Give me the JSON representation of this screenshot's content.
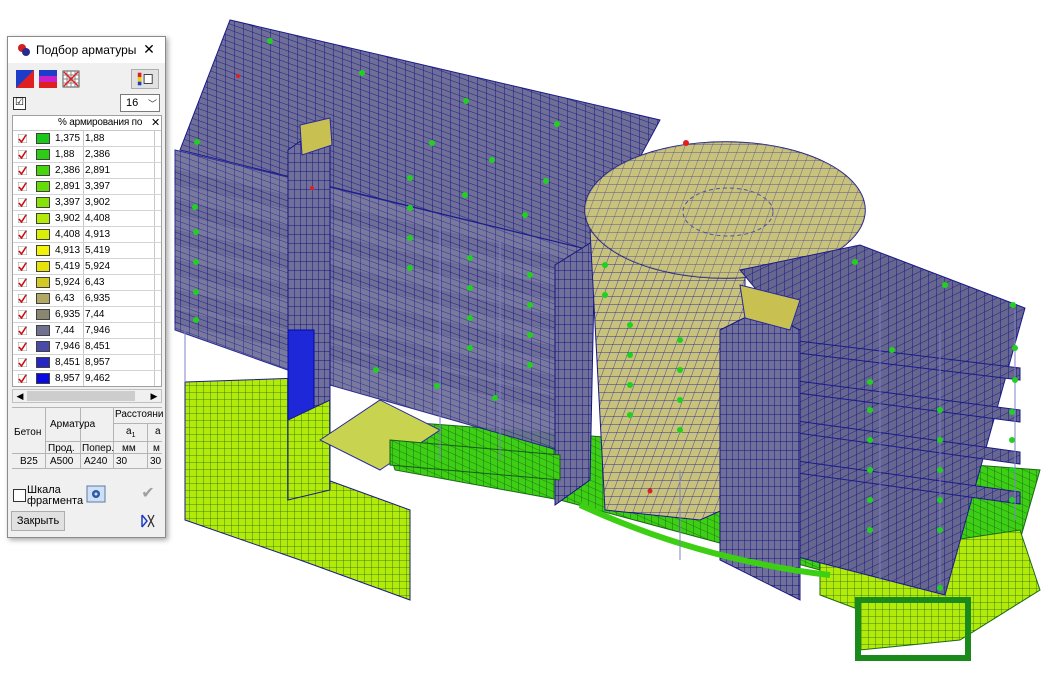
{
  "dialog": {
    "title": "Подбор арматуры",
    "close_glyph": "✕",
    "combo_value": "16",
    "checkbox_checked": "☑",
    "grid_header": "% армирования по",
    "grid_header_close": "✕",
    "rows": [
      {
        "from": "1,375",
        "to": "1,88",
        "color": "#19c819"
      },
      {
        "from": "1,88",
        "to": "2,386",
        "color": "#2ccd14"
      },
      {
        "from": "2,386",
        "to": "2,891",
        "color": "#46d40d"
      },
      {
        "from": "2,891",
        "to": "3,397",
        "color": "#64dc0a"
      },
      {
        "from": "3,397",
        "to": "3,902",
        "color": "#86e20a"
      },
      {
        "from": "3,902",
        "to": "4,408",
        "color": "#b4ea0a"
      },
      {
        "from": "4,408",
        "to": "4,913",
        "color": "#d9ef0a"
      },
      {
        "from": "4,913",
        "to": "5,419",
        "color": "#f2f20a"
      },
      {
        "from": "5,419",
        "to": "5,924",
        "color": "#e6e20a"
      },
      {
        "from": "5,924",
        "to": "6,43",
        "color": "#d2c826"
      },
      {
        "from": "6,43",
        "to": "6,935",
        "color": "#b0a864"
      },
      {
        "from": "6,935",
        "to": "7,44",
        "color": "#8a8670"
      },
      {
        "from": "7,44",
        "to": "7,946",
        "color": "#707090"
      },
      {
        "from": "7,946",
        "to": "8,451",
        "color": "#4a4aa8"
      },
      {
        "from": "8,451",
        "to": "8,957",
        "color": "#2626c0"
      },
      {
        "from": "8,957",
        "to": "9,462",
        "color": "#0a0ae0"
      }
    ],
    "material_table": {
      "h_concrete": "Бетон",
      "h_rebar": "Арматура",
      "h_distance": "Расстояни",
      "h_a1": "a",
      "h_a1_sub": "1",
      "h_a2": "a",
      "h_long": "Прод.",
      "h_trans": "Попер.",
      "unit1": "мм",
      "unit2": "м",
      "concrete": "B25",
      "long": "A500",
      "trans": "A240",
      "a1": "30",
      "a2": "30"
    },
    "fragment_scale_line1": "Шкала",
    "fragment_scale_line2": "фрагмента",
    "close_button": "Закрыть",
    "apply_glyph": "✔"
  }
}
